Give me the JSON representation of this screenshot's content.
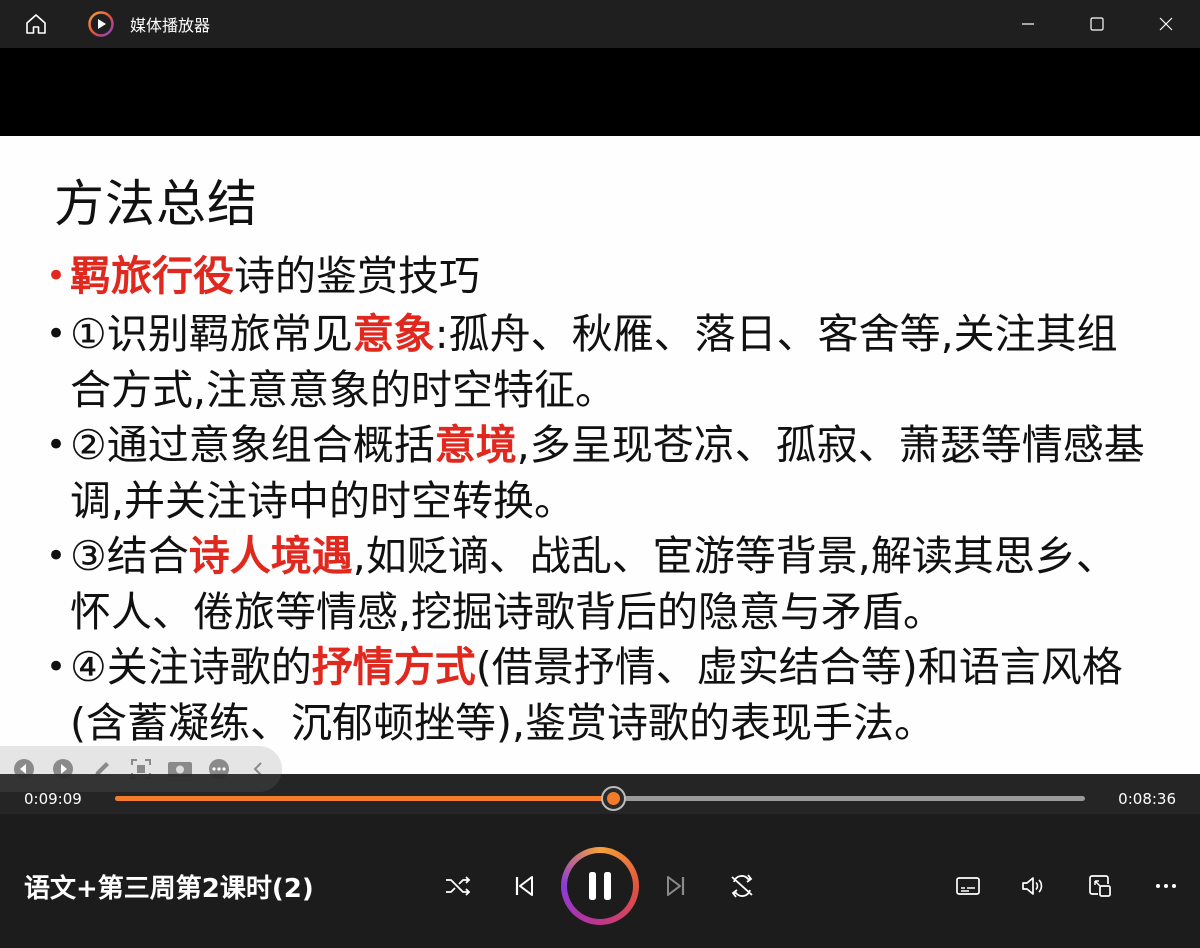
{
  "window": {
    "title": "媒体播放器"
  },
  "slide": {
    "title": "方法总结",
    "bullets": [
      {
        "parts": [
          {
            "text": "羁旅行役",
            "hl": true
          },
          {
            "text": "诗的鉴赏技巧",
            "hl": false
          }
        ]
      },
      {
        "parts": [
          {
            "text": "①识别羁旅常见",
            "hl": false
          },
          {
            "text": "意象",
            "hl": true
          },
          {
            "text": ":孤舟、秋雁、落日、客舍等,关注其组合方式,注意意象的时空特征。",
            "hl": false
          }
        ]
      },
      {
        "parts": [
          {
            "text": "②通过意象组合概括",
            "hl": false
          },
          {
            "text": "意境",
            "hl": true
          },
          {
            "text": ",多呈现苍凉、孤寂、萧瑟等情感基调,并关注诗中的时空转换。",
            "hl": false
          }
        ]
      },
      {
        "parts": [
          {
            "text": "③结合",
            "hl": false
          },
          {
            "text": "诗人境遇",
            "hl": true
          },
          {
            "text": ",如贬谪、战乱、宦游等背景,解读其思乡、怀人、倦旅等情感,挖掘诗歌背后的隐意与矛盾。",
            "hl": false
          }
        ]
      },
      {
        "parts": [
          {
            "text": "④关注诗歌的",
            "hl": false
          },
          {
            "text": "抒情方式",
            "hl": true
          },
          {
            "text": "(借景抒情、虚实结合等)和语言风格(含蓄凝练、沉郁顿挫等),鉴赏诗歌的表现手法。",
            "hl": false
          }
        ]
      }
    ]
  },
  "player": {
    "current_time": "0:09:09",
    "total_time": "0:08:36",
    "progress": 0.513,
    "media_title": "语文+第三周第2课时(2)"
  },
  "colors": {
    "accent": "#f47b2a",
    "highlight": "#e0281e",
    "titlebar": "#1f1f1f",
    "controls_bg": "#1c1c1c"
  },
  "icons": {
    "titlebar": [
      "home-icon",
      "app-play-icon",
      "minimize-icon",
      "maximize-icon",
      "close-icon"
    ],
    "annotation": [
      "prev-slide-icon",
      "next-slide-icon",
      "pen-icon",
      "screenshot-icon",
      "camera-icon",
      "more-icon",
      "collapse-icon"
    ],
    "controls": [
      "shuffle-icon",
      "previous-icon",
      "pause-icon",
      "next-icon",
      "repeat-icon",
      "subtitles-icon",
      "volume-icon",
      "mini-player-icon",
      "more-options-icon"
    ]
  }
}
